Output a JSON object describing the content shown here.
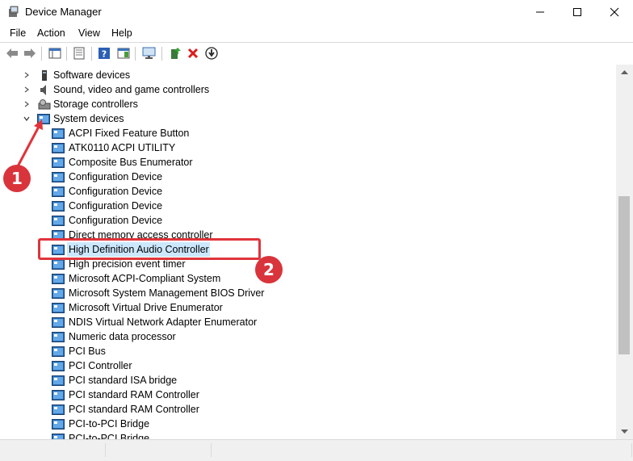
{
  "window": {
    "title": "Device Manager"
  },
  "menu": [
    "File",
    "Action",
    "View",
    "Help"
  ],
  "tree": {
    "categories": [
      {
        "label": "Software devices",
        "icon": "software-device-icon",
        "expanded": false
      },
      {
        "label": "Sound, video and game controllers",
        "icon": "speaker-icon",
        "expanded": false
      },
      {
        "label": "Storage controllers",
        "icon": "storage-icon",
        "expanded": false
      },
      {
        "label": "System devices",
        "icon": "system-device-icon",
        "expanded": true
      }
    ],
    "system_devices": [
      "ACPI Fixed Feature Button",
      "ATK0110 ACPI UTILITY",
      "Composite Bus Enumerator",
      "Configuration Device",
      "Configuration Device",
      "Configuration Device",
      "Configuration Device",
      "Direct memory access controller",
      "High Definition Audio Controller",
      "High precision event timer",
      "Microsoft ACPI-Compliant System",
      "Microsoft System Management BIOS Driver",
      "Microsoft Virtual Drive Enumerator",
      "NDIS Virtual Network Adapter Enumerator",
      "Numeric data processor",
      "PCI Bus",
      "PCI Controller",
      "PCI standard ISA bridge",
      "PCI standard RAM Controller",
      "PCI standard RAM Controller",
      "PCI-to-PCI Bridge",
      "PCI-to-PCI Bridge"
    ],
    "selected": "High Definition Audio Controller"
  },
  "annotations": {
    "step1": "1",
    "step2": "2",
    "color": "#e0343b"
  },
  "colors": {
    "selection": "#cce8ff",
    "accent": "#0078d7"
  }
}
